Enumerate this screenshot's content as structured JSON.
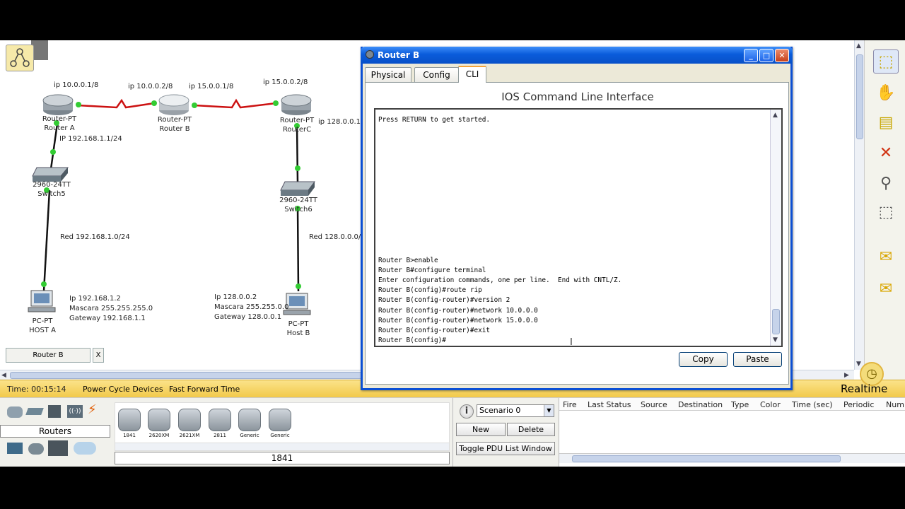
{
  "workspace": {
    "labels": {
      "ip_a": "ip 10.0.0.1/8",
      "ip_b_left": "ip 10.0.0.2/8",
      "ip_b_right": "ip 15.0.0.1/8",
      "ip_c": "ip 15.0.0.2/8",
      "ip_c_lan": "ip 128.0.0.1/",
      "ip_a_lan": "IP 192.168.1.1/24",
      "router_a_model": "Router-PT",
      "router_a_name": "Router A",
      "router_b_model": "Router-PT",
      "router_b_name": "Router B",
      "router_c_model": "Router-PT",
      "router_c_name": "RouterC",
      "switch5_model": "2960-24TT",
      "switch5_name": "Switch5",
      "switch6_model": "2960-24TT",
      "switch6_name": "Switch6",
      "net_left": "Red 192.168.1.0/24",
      "net_right": "Red 128.0.0.0/",
      "host_a_ip": "Ip 192.168.1.2",
      "host_a_mask": "Mascara 255.255.255.0",
      "host_a_gw": "Gateway 192.168.1.1",
      "host_b_ip": "Ip 128.0.0.2",
      "host_b_mask": "Mascara 255.255.0.0",
      "host_b_gw": "Gateway 128.0.0.1",
      "host_a_model": "PC-PT",
      "host_a_name": "HOST A",
      "host_b_model": "PC-PT",
      "host_b_name": "Host B"
    },
    "tag": {
      "label": "Router B",
      "close": "X"
    }
  },
  "icons": {
    "logical_nav": "network-tree-icon",
    "select": "select-icon",
    "move": "hand-icon",
    "note": "note-icon",
    "delete": "delete-icon",
    "inspect": "magnify-icon",
    "resize": "resize-icon",
    "add_simple_pdu": "envelope-icon",
    "add_complex_pdu": "envelope-open-icon",
    "realtime": "clock-icon",
    "info": "info-icon"
  },
  "status_bar": {
    "time": "Time: 00:15:14",
    "power_cycle": "Power Cycle Devices",
    "fast_forward": "Fast Forward Time",
    "mode": "Realtime"
  },
  "bottom": {
    "category": "Routers",
    "devices": [
      "1841",
      "2620XM",
      "2621XM",
      "2811",
      "Generic",
      "Generic"
    ],
    "selected_device": "1841",
    "scenario": "Scenario 0",
    "new_label": "New",
    "delete_label": "Delete",
    "toggle_label": "Toggle PDU List Window",
    "pdu_headers": [
      "Fire",
      "Last Status",
      "Source",
      "Destination",
      "Type",
      "Color",
      "Time (sec)",
      "Periodic",
      "Num"
    ]
  },
  "dialog": {
    "title": "Router B",
    "tabs": {
      "physical": "Physical",
      "config": "Config",
      "cli": "CLI"
    },
    "heading": "IOS Command Line Interface",
    "cli_lines": [
      "Press RETURN to get started.",
      "",
      "",
      "",
      "",
      "",
      "",
      "",
      "",
      "",
      "",
      "",
      "",
      "",
      "Router B>enable",
      "Router B#configure terminal",
      "Enter configuration commands, one per line.  End with CNTL/Z.",
      "Router B(config)#route rip",
      "Router B(config-router)#version 2",
      "Router B(config-router)#network 10.0.0.0",
      "Router B(config-router)#network 15.0.0.0",
      "Router B(config-router)#exit",
      "Router B(config)#"
    ],
    "copy_label": "Copy",
    "paste_label": "Paste",
    "window_buttons": {
      "minimize": "_",
      "maximize": "□",
      "close": "✕"
    }
  },
  "colors": {
    "serial_link": "#cc1111",
    "ethernet_link": "#111111",
    "link_up": "#33cc33",
    "title_bar": "#0a5cdb",
    "status_bar": "#f5d35f"
  }
}
